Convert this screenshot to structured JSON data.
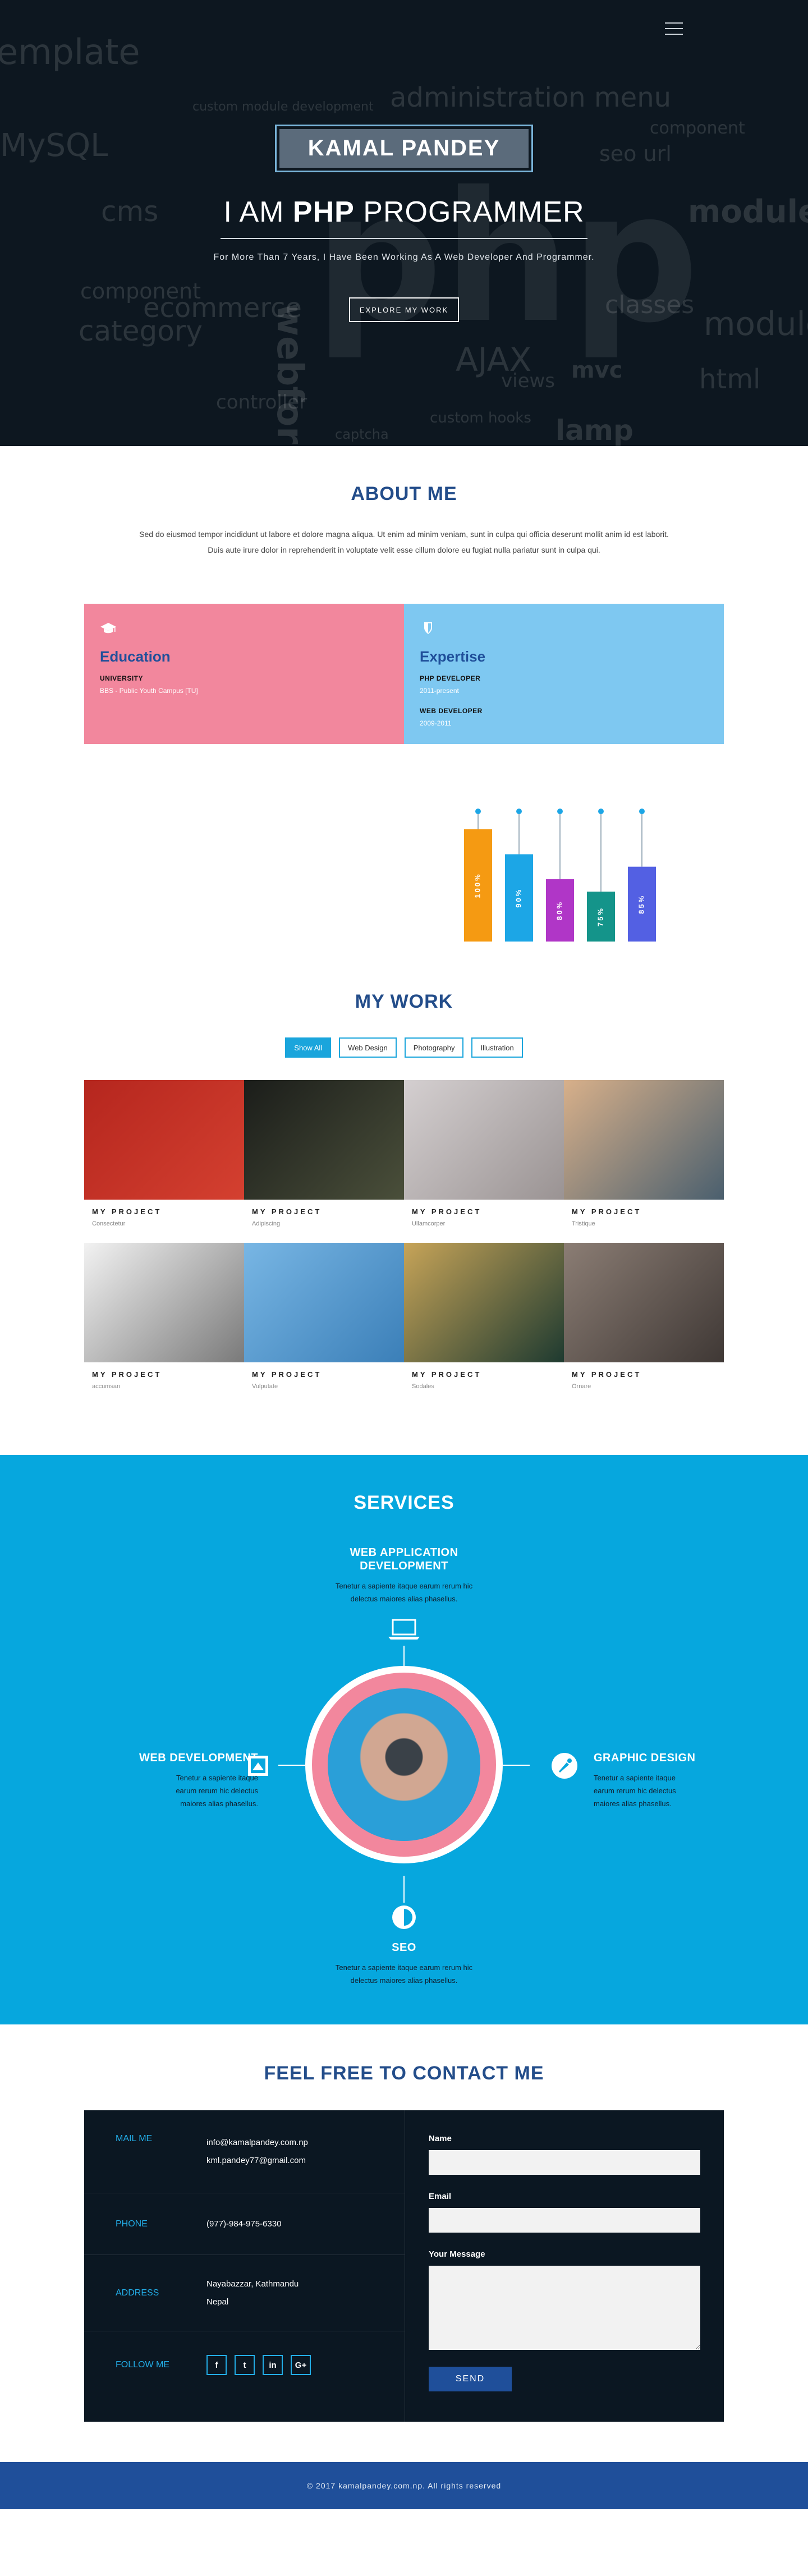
{
  "hero": {
    "name": "KAMAL PANDEY",
    "title_pre": "I AM",
    "title_bold": "PHP",
    "title_post": "PROGRAMMER",
    "subtitle": "For More Than 7 Years, I Have Been Working As A Web Developer And Programmer.",
    "cta": "EXPLORE MY WORK",
    "cloud_words": [
      "emplate",
      "custom module development",
      "administration menu",
      "MySQL",
      "component",
      "seo url",
      "cms",
      "module",
      "ecommerce",
      "component",
      "classes",
      "category",
      "module",
      "AJAX",
      "mvc",
      "html",
      "views",
      "controller",
      "custom hooks",
      "lamp",
      "captcha",
      "webform",
      "php"
    ]
  },
  "about": {
    "title": "ABOUT ME",
    "text_line1": "Sed do eiusmod tempor incididunt ut labore et dolore magna aliqua. Ut enim ad minim veniam, sunt in culpa qui officia deserunt mollit anim id est laborit.",
    "text_line2": "Duis aute irure dolor in reprehenderit in voluptate velit esse cillum dolore eu fugiat nulla pariatur sunt in culpa qui.",
    "education": {
      "title": "Education",
      "row1": "UNIVERSITY",
      "row2": "BBS - Public Youth Campus [TU]",
      "color": "#f2879d"
    },
    "expertise": {
      "title": "Expertise",
      "row1": "PHP DEVELOPER",
      "row2": "2011-present",
      "row3": "WEB DEVELOPER",
      "row4": "2009-2011",
      "color": "#7ec8f1"
    }
  },
  "chart_data": {
    "type": "bar",
    "categories": [
      "",
      "",
      "",
      "",
      ""
    ],
    "values": [
      100,
      90,
      80,
      75,
      85
    ],
    "labels": [
      "100%",
      "90%",
      "80%",
      "75%",
      "85%"
    ],
    "colors": [
      "#f59a12",
      "#1ca6e6",
      "#b036c7",
      "#14948a",
      "#5360e3"
    ],
    "ylim": [
      0,
      100
    ]
  },
  "work": {
    "title": "MY WORK",
    "filters": [
      "Show All",
      "Web Design",
      "Photography",
      "Illustration"
    ],
    "projects": [
      {
        "title": "MY PROJECT",
        "sub": "Consectetur",
        "c1": "#b5261e",
        "c2": "#d44030"
      },
      {
        "title": "MY PROJECT",
        "sub": "Adipiscing",
        "c1": "#1b1d1a",
        "c2": "#4a4f3a"
      },
      {
        "title": "MY PROJECT",
        "sub": "Ullamcorper",
        "c1": "#d4cfd0",
        "c2": "#9a9393"
      },
      {
        "title": "MY PROJECT",
        "sub": "Tristique",
        "c1": "#d8b08a",
        "c2": "#4a5f6e"
      },
      {
        "title": "MY PROJECT",
        "sub": "accumsan",
        "c1": "#f2f2f2",
        "c2": "#7a7a7a"
      },
      {
        "title": "MY PROJECT",
        "sub": "Vulputate",
        "c1": "#78b6e4",
        "c2": "#3b7fb8"
      },
      {
        "title": "MY PROJECT",
        "sub": "Sodales",
        "c1": "#c7a458",
        "c2": "#1e3a30"
      },
      {
        "title": "MY PROJECT",
        "sub": "Ornare",
        "c1": "#8b7d74",
        "c2": "#3f3835"
      }
    ]
  },
  "services": {
    "title": "SERVICES",
    "s1": {
      "title_l1": "WEB APPLICATION",
      "title_l2": "DEVELOPMENT",
      "p1": "Tenetur a sapiente itaque earum rerum hic",
      "p2": "delectus maiores alias phasellus."
    },
    "s2": {
      "title": "WEB DEVELOPMENT",
      "p1": "Tenetur a sapiente itaque",
      "p2": "earum rerum hic delectus",
      "p3": "maiores alias phasellus."
    },
    "s3": {
      "title": "GRAPHIC DESIGN",
      "p1": "Tenetur a sapiente itaque",
      "p2": "earum rerum hic delectus",
      "p3": "maiores alias phasellus."
    },
    "s4": {
      "title": "SEO",
      "p1": "Tenetur a sapiente itaque earum rerum hic",
      "p2": "delectus maiores alias phasellus."
    }
  },
  "contact": {
    "title": "FEEL FREE TO CONTACT ME",
    "mail_label": "MAIL ME",
    "mail1": "info@kamalpandey.com.np",
    "mail2": "kml.pandey77@gmail.com",
    "phone_label": "PHONE",
    "phone": "(977)-984-975-6330",
    "address_label": "ADDRESS",
    "address1": "Nayabazzar, Kathmandu",
    "address2": "Nepal",
    "follow_label": "FOLLOW ME",
    "social": [
      "f",
      "t",
      "in",
      "G+"
    ],
    "name_label": "Name",
    "email_label": "Email",
    "message_label": "Your Message",
    "send": "SEND"
  },
  "footer": {
    "text": "© 2017 kamalpandey.com.np. All rights reserved"
  }
}
